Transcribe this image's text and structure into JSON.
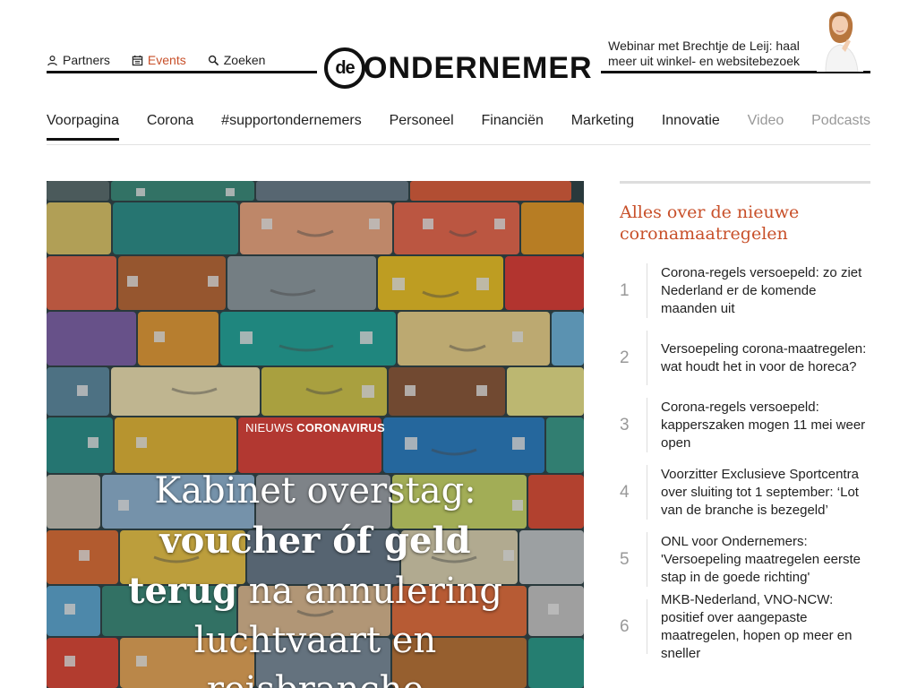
{
  "utility_links": {
    "partners": "Partners",
    "events": "Events",
    "search": "Zoeken"
  },
  "logo": {
    "mark": "de",
    "word": "ONDERNEMER"
  },
  "webinar": {
    "text": "Webinar met Brechtje de Leij: haal meer uit winkel- en websitebezoek"
  },
  "nav": {
    "items": [
      {
        "label": "Voorpagina"
      },
      {
        "label": "Corona"
      },
      {
        "label": "#supportondernemers"
      },
      {
        "label": "Personeel"
      },
      {
        "label": "Financiën"
      },
      {
        "label": "Marketing"
      },
      {
        "label": "Innovatie"
      },
      {
        "label": "Video"
      },
      {
        "label": "Podcasts"
      }
    ]
  },
  "hero": {
    "kicker_prefix": "NIEUWS",
    "kicker_topic": "CORONAVIRUS",
    "title_part1": "Kabinet overstag: ",
    "title_bold": "voucher óf geld terug",
    "title_part2": " na annulering luchtvaart en reisbranche"
  },
  "sidebar": {
    "title": "Alles over de nieuwe coronamaatregelen",
    "items": [
      {
        "number": "1",
        "text": "Corona-regels versoepeld: zo ziet Nederland er de komende maanden uit"
      },
      {
        "number": "2",
        "text": "Versoepeling corona-maatregelen: wat houdt het in voor de horeca?"
      },
      {
        "number": "3",
        "text": "Corona-regels versoepeld: kappers­zaken mogen 11 mei weer open"
      },
      {
        "number": "4",
        "text": "Voorzitter Exclusieve Sportcentra over sluiting tot 1 september: ‘Lot van de branche is bezegeld’"
      },
      {
        "number": "5",
        "text": "ONL voor Ondernemers: 'Versoepeling maatregelen eerste stap in de goede richting'"
      },
      {
        "number": "6",
        "text": "MKB-Nederland, VNO-NCW: positief over aangepaste maatregelen, hopen op meer en sneller"
      }
    ]
  },
  "colors": {
    "accent": "#c8502a",
    "text": "#222222",
    "muted": "#999999"
  }
}
